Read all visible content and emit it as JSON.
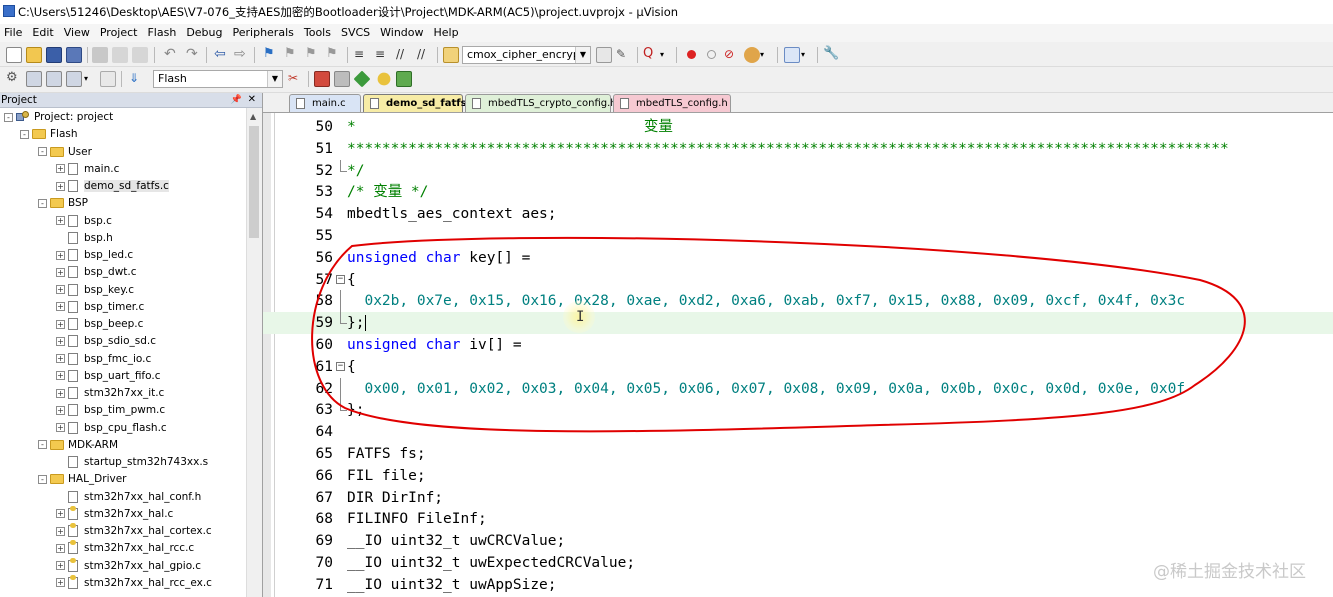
{
  "window": {
    "title": "C:\\Users\\51246\\Desktop\\AES\\V7-076_支持AES加密的Bootloader设计\\Project\\MDK-ARM(AC5)\\project.uvprojx - µVision"
  },
  "menu": [
    "File",
    "Edit",
    "View",
    "Project",
    "Flash",
    "Debug",
    "Peripherals",
    "Tools",
    "SVCS",
    "Window",
    "Help"
  ],
  "toolbar": {
    "function_combo": "cmox_cipher_encrypt",
    "target_combo": "Flash"
  },
  "project_panel": {
    "title": "Project",
    "tree": [
      {
        "label": "Project: project",
        "kind": "project",
        "level": 0,
        "toggle": "-"
      },
      {
        "label": "Flash",
        "kind": "folder",
        "level": 1,
        "toggle": "-"
      },
      {
        "label": "User",
        "kind": "folder",
        "level": 2,
        "toggle": "-"
      },
      {
        "label": "main.c",
        "kind": "file",
        "level": 3,
        "toggle": "+"
      },
      {
        "label": "demo_sd_fatfs.c",
        "kind": "file",
        "level": 3,
        "toggle": "+",
        "selected": true
      },
      {
        "label": "BSP",
        "kind": "folder",
        "level": 2,
        "toggle": "-"
      },
      {
        "label": "bsp.c",
        "kind": "file",
        "level": 3,
        "toggle": "+"
      },
      {
        "label": "bsp.h",
        "kind": "file",
        "level": 3,
        "toggle": ""
      },
      {
        "label": "bsp_led.c",
        "kind": "file",
        "level": 3,
        "toggle": "+"
      },
      {
        "label": "bsp_dwt.c",
        "kind": "file",
        "level": 3,
        "toggle": "+"
      },
      {
        "label": "bsp_key.c",
        "kind": "file",
        "level": 3,
        "toggle": "+"
      },
      {
        "label": "bsp_timer.c",
        "kind": "file",
        "level": 3,
        "toggle": "+"
      },
      {
        "label": "bsp_beep.c",
        "kind": "file",
        "level": 3,
        "toggle": "+"
      },
      {
        "label": "bsp_sdio_sd.c",
        "kind": "file",
        "level": 3,
        "toggle": "+"
      },
      {
        "label": "bsp_fmc_io.c",
        "kind": "file",
        "level": 3,
        "toggle": "+"
      },
      {
        "label": "bsp_uart_fifo.c",
        "kind": "file",
        "level": 3,
        "toggle": "+"
      },
      {
        "label": "stm32h7xx_it.c",
        "kind": "file",
        "level": 3,
        "toggle": "+"
      },
      {
        "label": "bsp_tim_pwm.c",
        "kind": "file",
        "level": 3,
        "toggle": "+"
      },
      {
        "label": "bsp_cpu_flash.c",
        "kind": "file",
        "level": 3,
        "toggle": "+"
      },
      {
        "label": "MDK-ARM",
        "kind": "folder",
        "level": 2,
        "toggle": "-"
      },
      {
        "label": "startup_stm32h743xx.s",
        "kind": "file",
        "level": 3,
        "toggle": ""
      },
      {
        "label": "HAL_Driver",
        "kind": "folder",
        "level": 2,
        "toggle": "-"
      },
      {
        "label": "stm32h7xx_hal_conf.h",
        "kind": "file",
        "level": 3,
        "toggle": ""
      },
      {
        "label": "stm32h7xx_hal.c",
        "kind": "keyfile",
        "level": 3,
        "toggle": "+"
      },
      {
        "label": "stm32h7xx_hal_cortex.c",
        "kind": "keyfile",
        "level": 3,
        "toggle": "+"
      },
      {
        "label": "stm32h7xx_hal_rcc.c",
        "kind": "keyfile",
        "level": 3,
        "toggle": "+"
      },
      {
        "label": "stm32h7xx_hal_gpio.c",
        "kind": "keyfile",
        "level": 3,
        "toggle": "+"
      },
      {
        "label": "stm32h7xx_hal_rcc_ex.c",
        "kind": "keyfile",
        "level": 3,
        "toggle": "+"
      }
    ]
  },
  "tabs": [
    {
      "label": "main.c",
      "color": "#d9e4f5",
      "active": false
    },
    {
      "label": "demo_sd_fatfs.c",
      "color": "#f7eca6",
      "active": true
    },
    {
      "label": "mbedTLS_crypto_config.h",
      "color": "#dff0d8",
      "active": false
    },
    {
      "label": "mbedTLS_config.h",
      "color": "#f6c9d2",
      "active": false
    }
  ],
  "code_lines": [
    {
      "n": "50",
      "parts": [
        [
          "*",
          "green"
        ],
        [
          "                                 变量",
          "green"
        ]
      ]
    },
    {
      "n": "51",
      "parts": [
        [
          "*****************************************************************************************************",
          "green"
        ]
      ]
    },
    {
      "n": "52",
      "parts": [
        [
          "*/",
          "green"
        ]
      ],
      "fold": "end"
    },
    {
      "n": "53",
      "parts": [
        [
          "/* 变量 */",
          "green"
        ]
      ]
    },
    {
      "n": "54",
      "parts": [
        [
          "mbedtls_aes_context aes;",
          "black"
        ]
      ]
    },
    {
      "n": "55",
      "parts": [
        [
          "",
          "black"
        ]
      ]
    },
    {
      "n": "56",
      "parts": [
        [
          "unsigned",
          "blue"
        ],
        [
          " ",
          "black"
        ],
        [
          "char",
          "blue"
        ],
        [
          " key[] =",
          "black"
        ]
      ]
    },
    {
      "n": "57",
      "parts": [
        [
          "{",
          "black"
        ]
      ],
      "fold": "open"
    },
    {
      "n": "58",
      "parts": [
        [
          "  0x2b, 0x7e, 0x15, 0x16, 0x28, 0xae, 0xd2, 0xa6, 0xab, 0xf7, 0x15, 0x88, 0x09, 0xcf, 0x4f, 0x3c",
          "teal"
        ]
      ],
      "fold": "line"
    },
    {
      "n": "59",
      "parts": [
        [
          "};",
          "black"
        ]
      ],
      "fold": "end",
      "highlight": true,
      "caret": true
    },
    {
      "n": "60",
      "parts": [
        [
          "unsigned",
          "blue"
        ],
        [
          " ",
          "black"
        ],
        [
          "char",
          "blue"
        ],
        [
          " iv[] =",
          "black"
        ]
      ]
    },
    {
      "n": "61",
      "parts": [
        [
          "{",
          "black"
        ]
      ],
      "fold": "open"
    },
    {
      "n": "62",
      "parts": [
        [
          "  0x00, 0x01, 0x02, 0x03, 0x04, 0x05, 0x06, 0x07, 0x08, 0x09, 0x0a, 0x0b, 0x0c, 0x0d, 0x0e, 0x0f",
          "teal"
        ]
      ],
      "fold": "line"
    },
    {
      "n": "63",
      "parts": [
        [
          "};",
          "black"
        ]
      ],
      "fold": "end"
    },
    {
      "n": "64",
      "parts": [
        [
          "",
          "black"
        ]
      ]
    },
    {
      "n": "65",
      "parts": [
        [
          "FATFS fs;",
          "black"
        ]
      ]
    },
    {
      "n": "66",
      "parts": [
        [
          "FIL file;",
          "black"
        ]
      ]
    },
    {
      "n": "67",
      "parts": [
        [
          "DIR DirInf;",
          "black"
        ]
      ]
    },
    {
      "n": "68",
      "parts": [
        [
          "FILINFO FileInf;",
          "black"
        ]
      ]
    },
    {
      "n": "69",
      "parts": [
        [
          "__IO uint32_t uwCRCValue;",
          "black"
        ]
      ]
    },
    {
      "n": "70",
      "parts": [
        [
          "__IO uint32_t uwExpectedCRCValue;",
          "black"
        ]
      ]
    },
    {
      "n": "71",
      "parts": [
        [
          "__IO uint32_t uwAppSize;",
          "black"
        ]
      ]
    }
  ],
  "watermark": "@稀土掘金技术社区"
}
